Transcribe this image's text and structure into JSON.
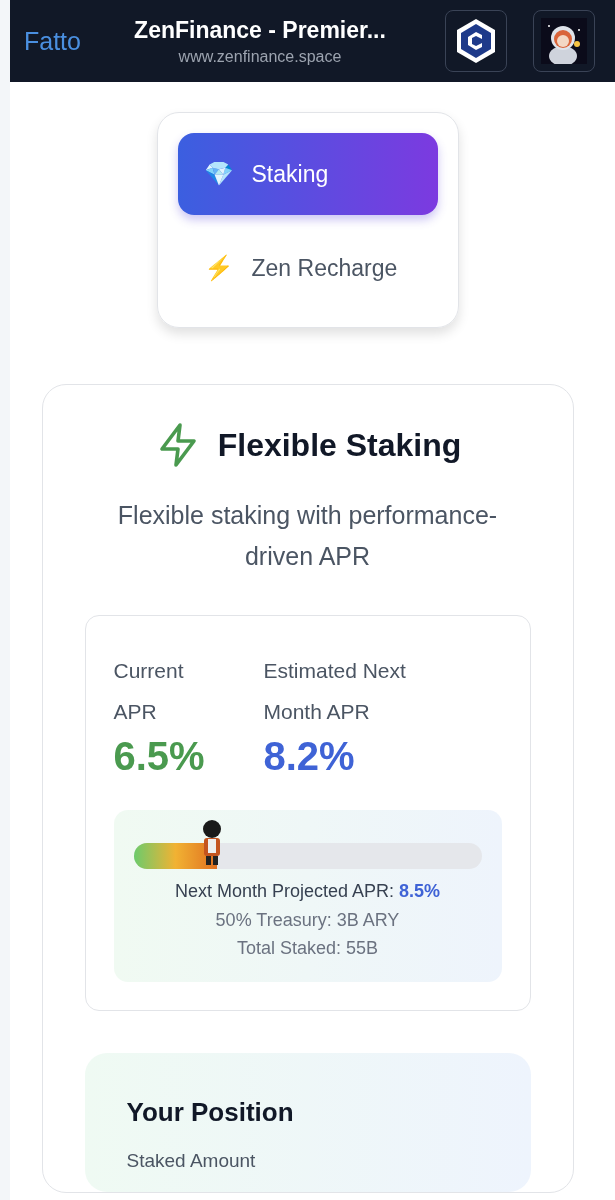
{
  "top_bar": {
    "done_label": "Fatto",
    "title": "ZenFinance - Premier...",
    "url": "www.zenfinance.space"
  },
  "tabs": [
    {
      "label": "Staking",
      "icon": "💎",
      "selected": true
    },
    {
      "label": "Zen Recharge",
      "icon": "⚡",
      "selected": false
    }
  ],
  "staking_card": {
    "title": "Flexible Staking",
    "subtitle": "Flexible staking with performance-driven APR",
    "apr": [
      {
        "label": "Current APR",
        "value": "6.5%",
        "color": "#4a9a4f"
      },
      {
        "label": "Estimated Next Month APR",
        "value": "8.2%",
        "color": "#3f63d6"
      }
    ],
    "progress": {
      "level": 0.24
    },
    "projected_label": "Next Month Projected APR:",
    "projected_value": "8.5%",
    "treasury": "50% Treasury: 3B ARY",
    "total_staked": "Total Staked: 55B"
  },
  "position": {
    "title": "Your Position",
    "staked_label": "Staked Amount"
  }
}
